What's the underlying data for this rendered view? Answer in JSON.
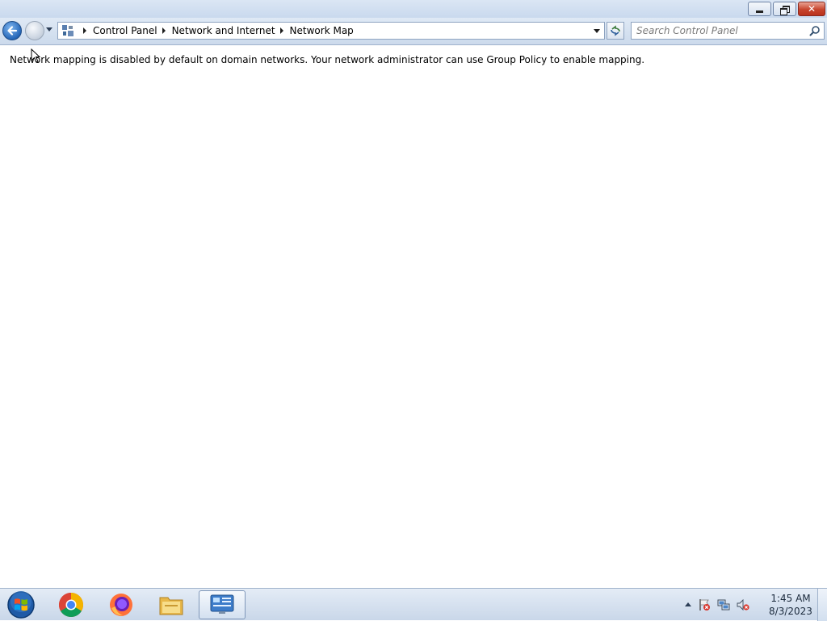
{
  "window": {
    "caption_buttons": {
      "minimize_icon": "minimize-icon",
      "maximize_icon": "restore-icon",
      "close_icon": "close-icon"
    }
  },
  "navigation": {
    "breadcrumbs": [
      "Control Panel",
      "Network and Internet",
      "Network Map"
    ],
    "search_placeholder": "Search Control Panel",
    "search_value": ""
  },
  "content": {
    "message": "Network mapping is disabled by default on domain networks. Your network administrator can use Group Policy to enable mapping."
  },
  "taskbar": {
    "pinned": [
      "chrome-icon",
      "firefox-icon",
      "file-explorer-icon",
      "control-panel-icon"
    ],
    "active_app": "control-panel-icon",
    "clock": {
      "time": "1:45 AM",
      "date": "8/3/2023"
    },
    "tray": [
      "action-center-icon",
      "network-icon",
      "volume-muted-icon"
    ]
  },
  "colors": {
    "title_bar": "#dbe6f4",
    "close_button": "#c7442d",
    "taskbar": "#d6e2f0",
    "back_button": "#2566b8"
  }
}
